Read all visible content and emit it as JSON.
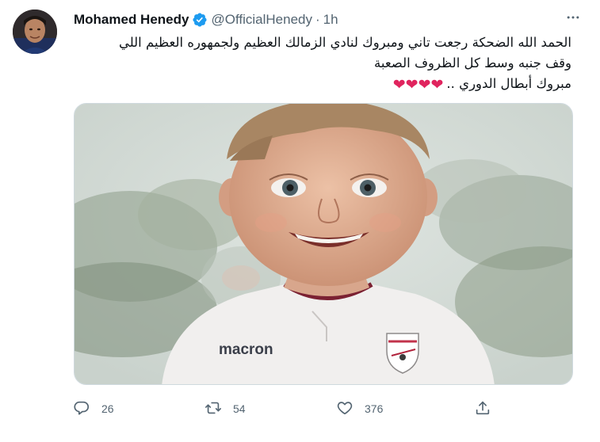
{
  "tweet": {
    "author_name": "Mohamed Henedy",
    "handle": "@OfficialHenedy",
    "separator": "·",
    "time": "1h",
    "text_lines": [
      "الحمد الله الضحكة رجعت تاني ومبروك لنادي الزمالك العظيم ولجمهوره العظيم اللي",
      "وقف جنبه وسط كل الظروف الصعبة",
      "مبروك أبطال الدوري .."
    ],
    "hearts": "❤❤❤❤",
    "jersey_logo_text": "macron"
  },
  "actions": {
    "reply_count": "26",
    "retweet_count": "54",
    "like_count": "376"
  },
  "icons": [
    "verified-badge-icon",
    "more-icon",
    "reply-icon",
    "retweet-icon",
    "like-icon",
    "share-icon"
  ],
  "colors": {
    "verified": "#1d9bf0",
    "secondary_text": "#536471",
    "heart": "#e0245e",
    "primary_text": "#0f1419"
  }
}
